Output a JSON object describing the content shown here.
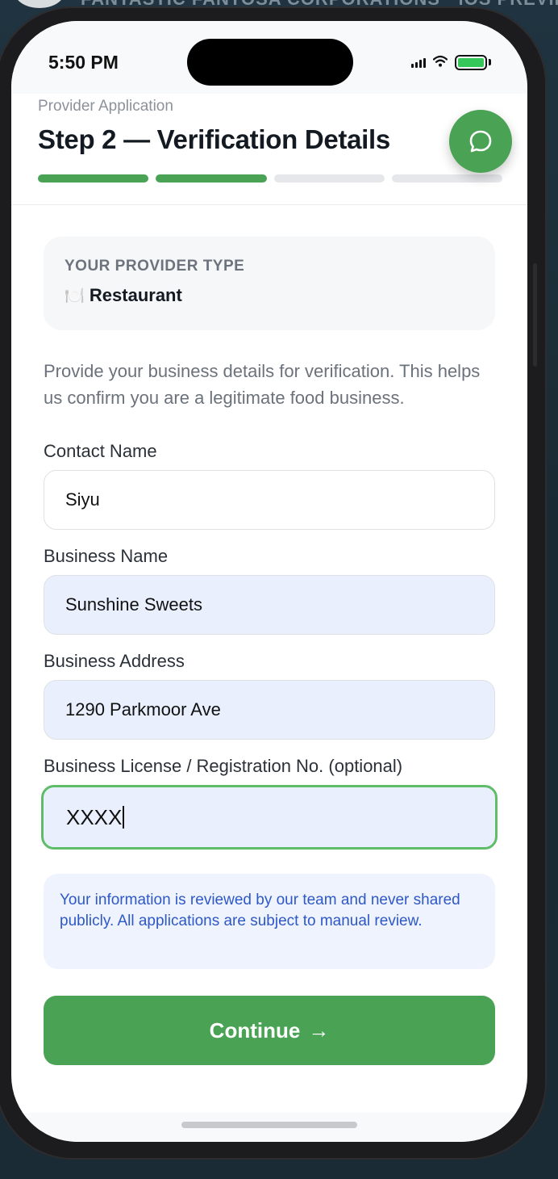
{
  "backdrop": {
    "title": "FANTASTIC FANTOSA CORPORATIONS · iOS PREVIEW"
  },
  "status_bar": {
    "time": "5:50 PM",
    "battery_icon": "battery-icon",
    "wifi_icon": "wifi-icon",
    "signal_icon": "signal-icon"
  },
  "header": {
    "eyebrow": "Provider Application",
    "title": "Step 2 — Verification Details",
    "progress": {
      "total_steps": 4,
      "completed_steps": 2
    },
    "chat_icon": "chat-bubble-icon"
  },
  "provider_type": {
    "label": "YOUR PROVIDER TYPE",
    "icon": "🍽️",
    "value": "Restaurant"
  },
  "intro": "Provide your business details for verification. This helps us confirm you are a legitimate food business.",
  "fields": {
    "contact_name": {
      "label": "Contact Name",
      "value": "Siyu"
    },
    "business_name": {
      "label": "Business Name",
      "value": "Sunshine Sweets"
    },
    "business_address": {
      "label": "Business Address",
      "value": "1290 Parkmoor Ave"
    },
    "license": {
      "label": "Business License / Registration No. (optional)",
      "value": "XXXX"
    }
  },
  "notice": "Your information is reviewed by our team and never shared publicly. All applications are subject to manual review.",
  "continue": {
    "label": "Continue",
    "arrow": "→"
  },
  "colors": {
    "brand_green": "#4aa354",
    "focus_border": "#5fbd6a",
    "filled_field_bg": "#e9effd",
    "notice_text": "#2f58c7"
  }
}
